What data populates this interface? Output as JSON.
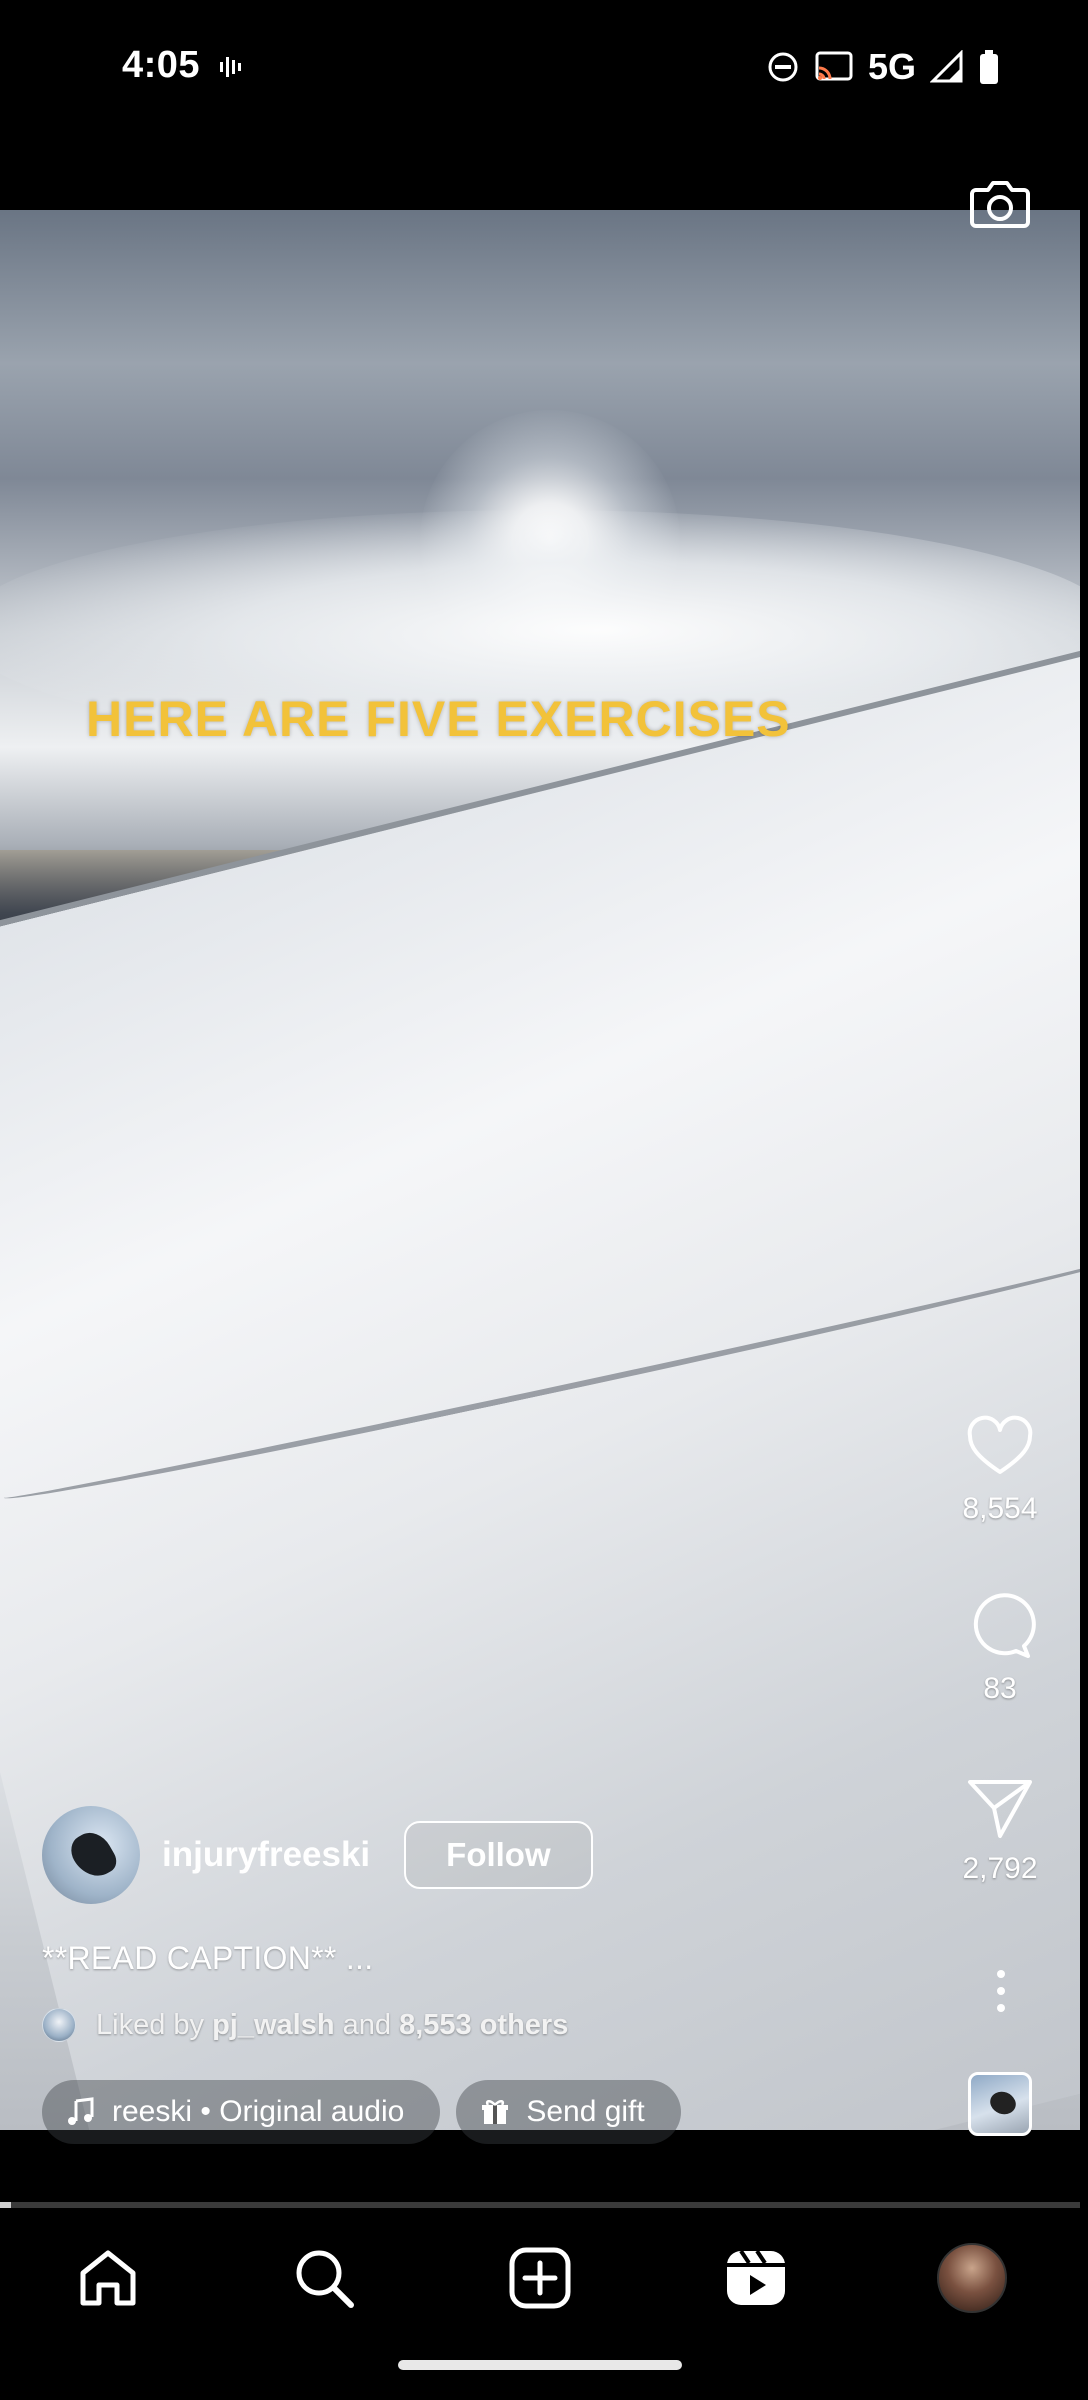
{
  "status_bar": {
    "time": "4:05",
    "network": "5G",
    "icons": [
      "vibrate-icon",
      "do-not-disturb-icon",
      "cast-icon",
      "signal-icon",
      "battery-icon"
    ]
  },
  "video": {
    "overlay_text": "HERE ARE FIVE EXERCISES",
    "overlay_color": "#f2c23a"
  },
  "actions": {
    "likes": "8,554",
    "comments": "83",
    "shares": "2,792"
  },
  "author": {
    "username": "injuryfreeski",
    "follow_label": "Follow"
  },
  "caption": "**READ CAPTION** ...",
  "liked_by": {
    "prefix": "Liked by",
    "user": "pj_walsh",
    "connector": "and",
    "others": "8,553 others"
  },
  "audio": {
    "label": "reeski • Original audio"
  },
  "gift": {
    "label": "Send gift"
  },
  "progress": 0.01,
  "nav": {
    "items": [
      "home",
      "search",
      "create",
      "reels",
      "profile"
    ],
    "active": "reels"
  }
}
